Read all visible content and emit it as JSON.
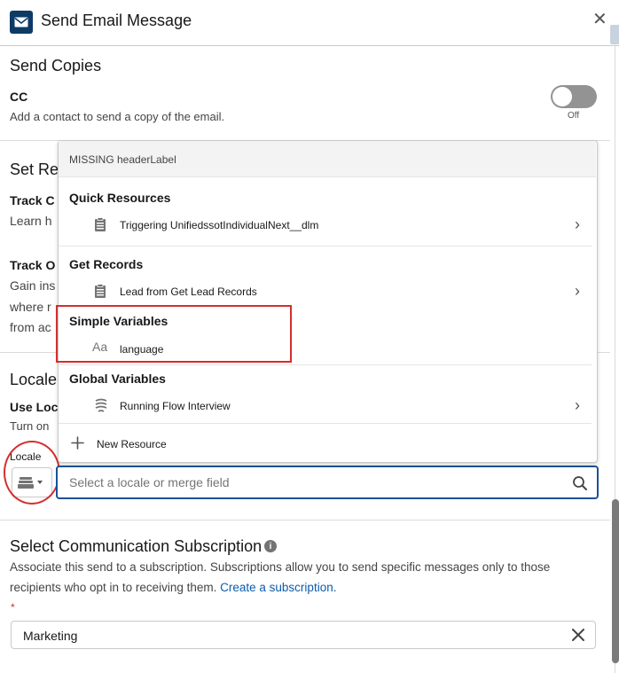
{
  "header": {
    "title": "Send Email Message"
  },
  "send_copies": {
    "title": "Send Copies",
    "cc_label": "CC",
    "cc_desc": "Add a contact to send a copy of the email.",
    "toggle_state": "Off"
  },
  "set_records": {
    "title": "Set Rec",
    "track_clicks_label": "Track C",
    "track_clicks_desc": "Learn h",
    "track_opens_label": "Track O",
    "track_opens_desc_1": "Gain ins",
    "track_opens_desc_2": "where r",
    "track_opens_desc_3": "from ac"
  },
  "locale_section": {
    "title": "Locale",
    "use_locale_label": "Use Loc",
    "use_locale_desc": "Turn on",
    "field_label": "Locale",
    "input_placeholder": "Select a locale or merge field"
  },
  "dropdown": {
    "header_label": "MISSING headerLabel",
    "groups": [
      {
        "title": "Quick Resources",
        "items": [
          {
            "label": "Triggering UnifiedssotIndividualNext__dlm",
            "icon": "clipboard-icon",
            "has_children": true
          }
        ]
      },
      {
        "title": "Get Records",
        "items": [
          {
            "label": "Lead from Get Lead Records",
            "icon": "clipboard-icon",
            "has_children": true
          }
        ]
      },
      {
        "title": "Simple Variables",
        "items": [
          {
            "label": "language",
            "icon": "text-variable-icon",
            "icon_text": "Aa",
            "has_children": false
          }
        ]
      },
      {
        "title": "Global Variables",
        "items": [
          {
            "label": "Running Flow Interview",
            "icon": "flow-icon",
            "has_children": true
          }
        ]
      }
    ],
    "new_resource_label": "New Resource"
  },
  "subscription": {
    "title": "Select Communication Subscription",
    "desc_1": "Associate this send to a subscription. Subscriptions allow you to send specific messages only to those",
    "desc_2": "recipients who opt in to receiving them.",
    "link": "Create a subscription.",
    "required_marker": "*",
    "value": "Marketing"
  },
  "colors": {
    "accent": "#1b5297",
    "annotation_red": "#d32f2f",
    "header_icon_bg": "#0d3b66",
    "link": "#0b5cab"
  }
}
